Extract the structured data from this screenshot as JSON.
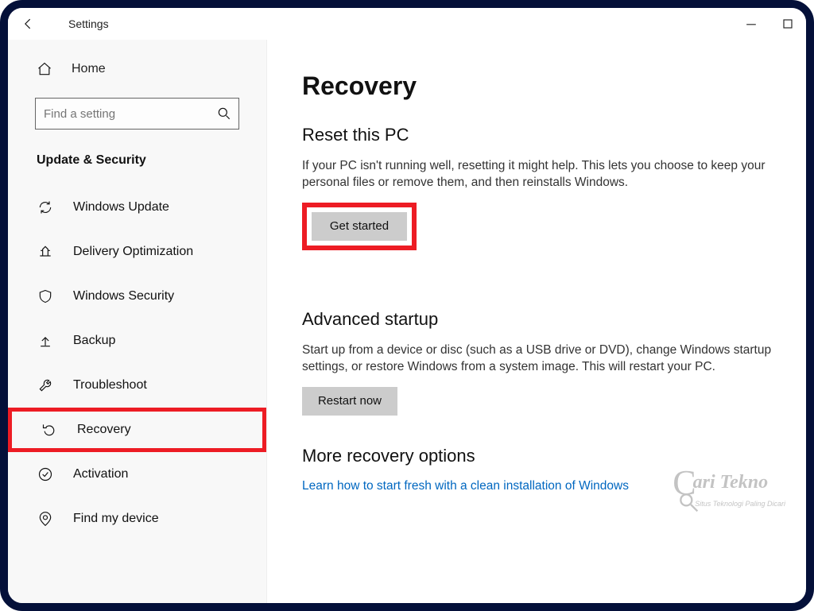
{
  "window": {
    "title": "Settings"
  },
  "sidebar": {
    "home_label": "Home",
    "search_placeholder": "Find a setting",
    "category": "Update & Security",
    "items": [
      {
        "label": "Windows Update"
      },
      {
        "label": "Delivery Optimization"
      },
      {
        "label": "Windows Security"
      },
      {
        "label": "Backup"
      },
      {
        "label": "Troubleshoot"
      },
      {
        "label": "Recovery"
      },
      {
        "label": "Activation"
      },
      {
        "label": "Find my device"
      }
    ]
  },
  "main": {
    "title": "Recovery",
    "reset": {
      "heading": "Reset this PC",
      "body": "If your PC isn't running well, resetting it might help. This lets you choose to keep your personal files or remove them, and then reinstalls Windows.",
      "button": "Get started"
    },
    "advanced": {
      "heading": "Advanced startup",
      "body": "Start up from a device or disc (such as a USB drive or DVD), change Windows startup settings, or restore Windows from a system image. This will restart your PC.",
      "button": "Restart now"
    },
    "more": {
      "heading": "More recovery options",
      "link": "Learn how to start fresh with a clean installation of Windows"
    }
  },
  "watermark": {
    "brand": "ari Tekno",
    "c": "C",
    "tagline": "Situs Teknologi Paling Dicari"
  }
}
